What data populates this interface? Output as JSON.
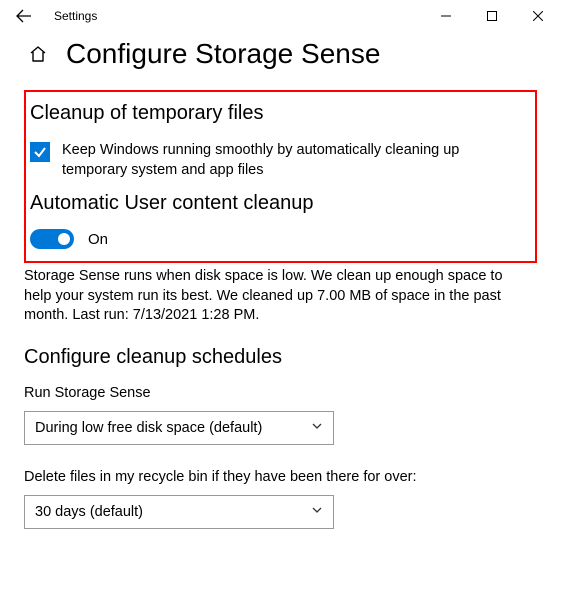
{
  "app_title": "Settings",
  "page_title": "Configure Storage Sense",
  "highlight": {
    "section1_title": "Cleanup of temporary files",
    "checkbox_label": "Keep Windows running smoothly by automatically cleaning up temporary system and app files",
    "checkbox_checked": true,
    "section2_title": "Automatic User content cleanup",
    "toggle_on": true,
    "toggle_label": "On"
  },
  "description": "Storage Sense runs when disk space is low. We clean up enough space to help your system run its best. We cleaned up 7.00 MB of space in the past month. Last run: 7/13/2021 1:28 PM.",
  "schedules_heading": "Configure cleanup schedules",
  "run_label": "Run Storage Sense",
  "run_selected": "During low free disk space (default)",
  "recycle_label": "Delete files in my recycle bin if they have been there for over:",
  "recycle_selected": "30 days (default)"
}
